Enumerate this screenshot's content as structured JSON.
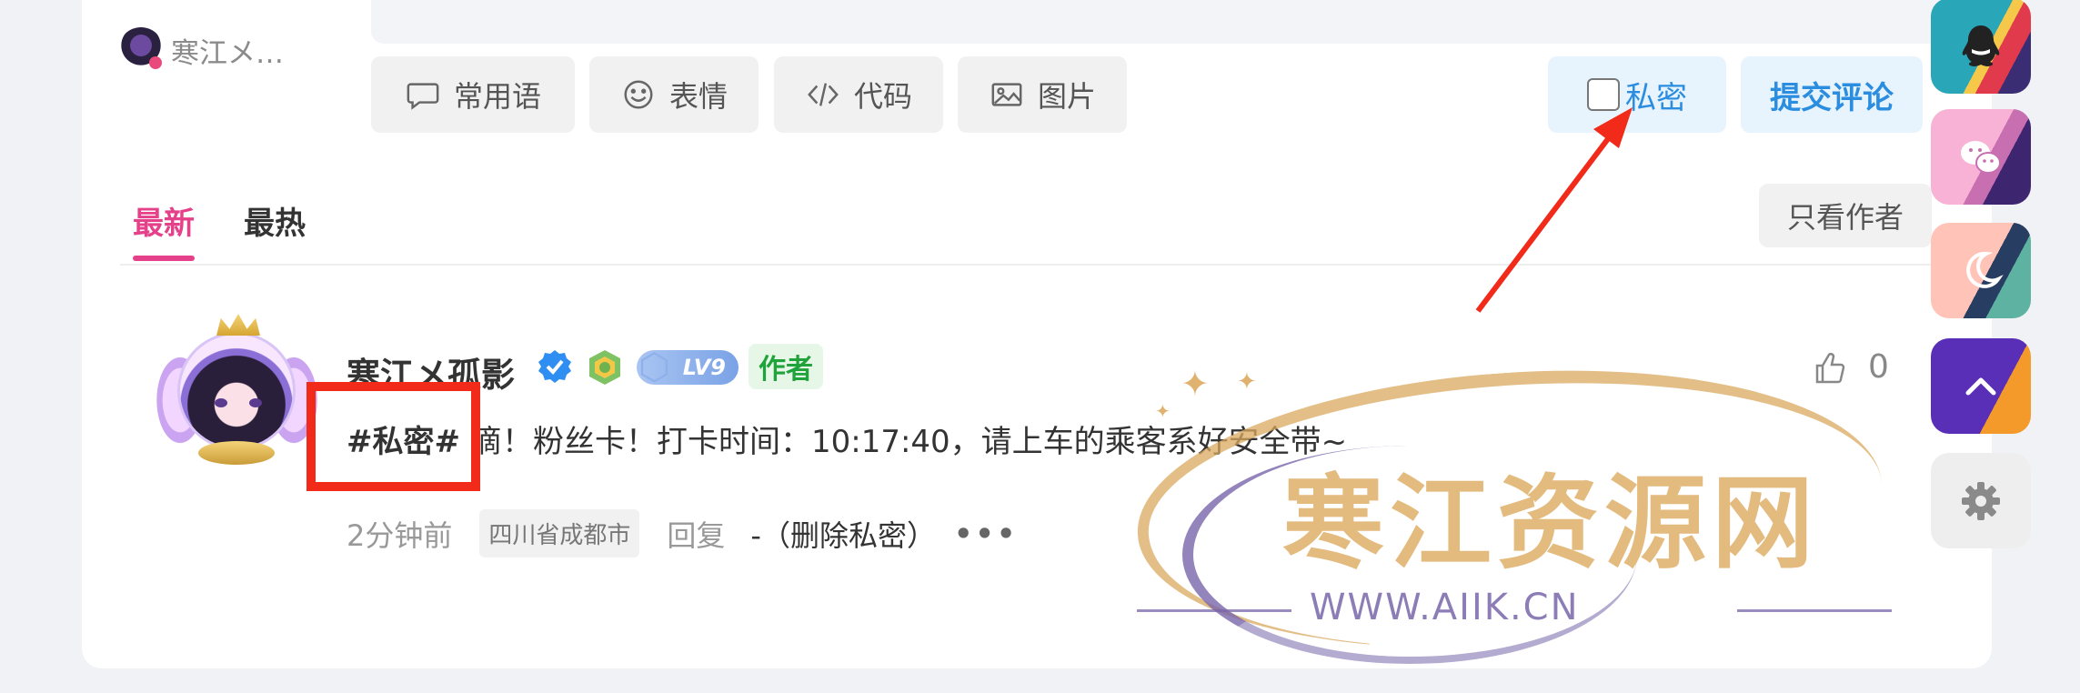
{
  "me": {
    "name": "寒江メ…"
  },
  "toolbar": {
    "phrases_label": "常用语",
    "emoji_label": "表情",
    "code_label": "代码",
    "image_label": "图片",
    "private_label": "私密",
    "submit_label": "提交评论"
  },
  "tabs": {
    "latest": "最新",
    "hot": "最热"
  },
  "filter": {
    "only_author": "只看作者"
  },
  "comment": {
    "username": "寒江メ孤影",
    "level": "LV9",
    "author_tag": "作者",
    "likes": "0",
    "private_tag": "#私密#",
    "text": "滴！粉丝卡！打卡时间：10:17:40，请上车的乘客系好安全带~",
    "time": "2分钟前",
    "location": "四川省成都市",
    "reply": "回复",
    "delete_private": "-（删除私密）",
    "more": "•••"
  },
  "watermark": {
    "title": "寒江资源网",
    "url": "WWW.AIIK.CN"
  },
  "sidebar": {
    "icons": [
      "qq-icon",
      "wechat-icon",
      "moon-icon",
      "chevron-up-icon",
      "gear-icon"
    ]
  },
  "colors": {
    "accent_pink": "#e4418a",
    "accent_blue": "#2b8de0",
    "author_green": "#1fa33a",
    "annotation_red": "#f12a1a"
  }
}
